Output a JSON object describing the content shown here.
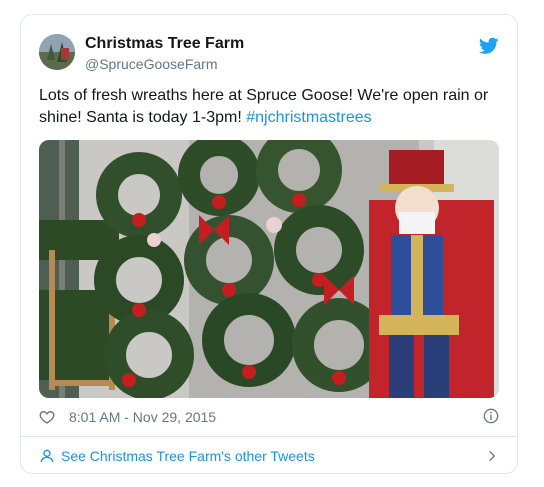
{
  "tweet": {
    "author_name": "Christmas Tree Farm",
    "author_handle": "@SpruceGooseFarm",
    "text": "Lots of fresh wreaths here at Spruce Goose!  We're open rain or shine!  Santa is today 1-3pm! ",
    "hashtag": "#njchristmastrees",
    "timestamp": "8:01 AM - Nov 29, 2015"
  },
  "footer": {
    "see_more": "See Christmas Tree Farm's other Tweets"
  },
  "colors": {
    "link": "#1b95e0",
    "secondary": "#657786",
    "border": "#e1e8ed"
  },
  "icons": [
    "twitter-bird-icon",
    "heart-icon",
    "info-icon",
    "person-icon",
    "chevron-right-icon"
  ]
}
